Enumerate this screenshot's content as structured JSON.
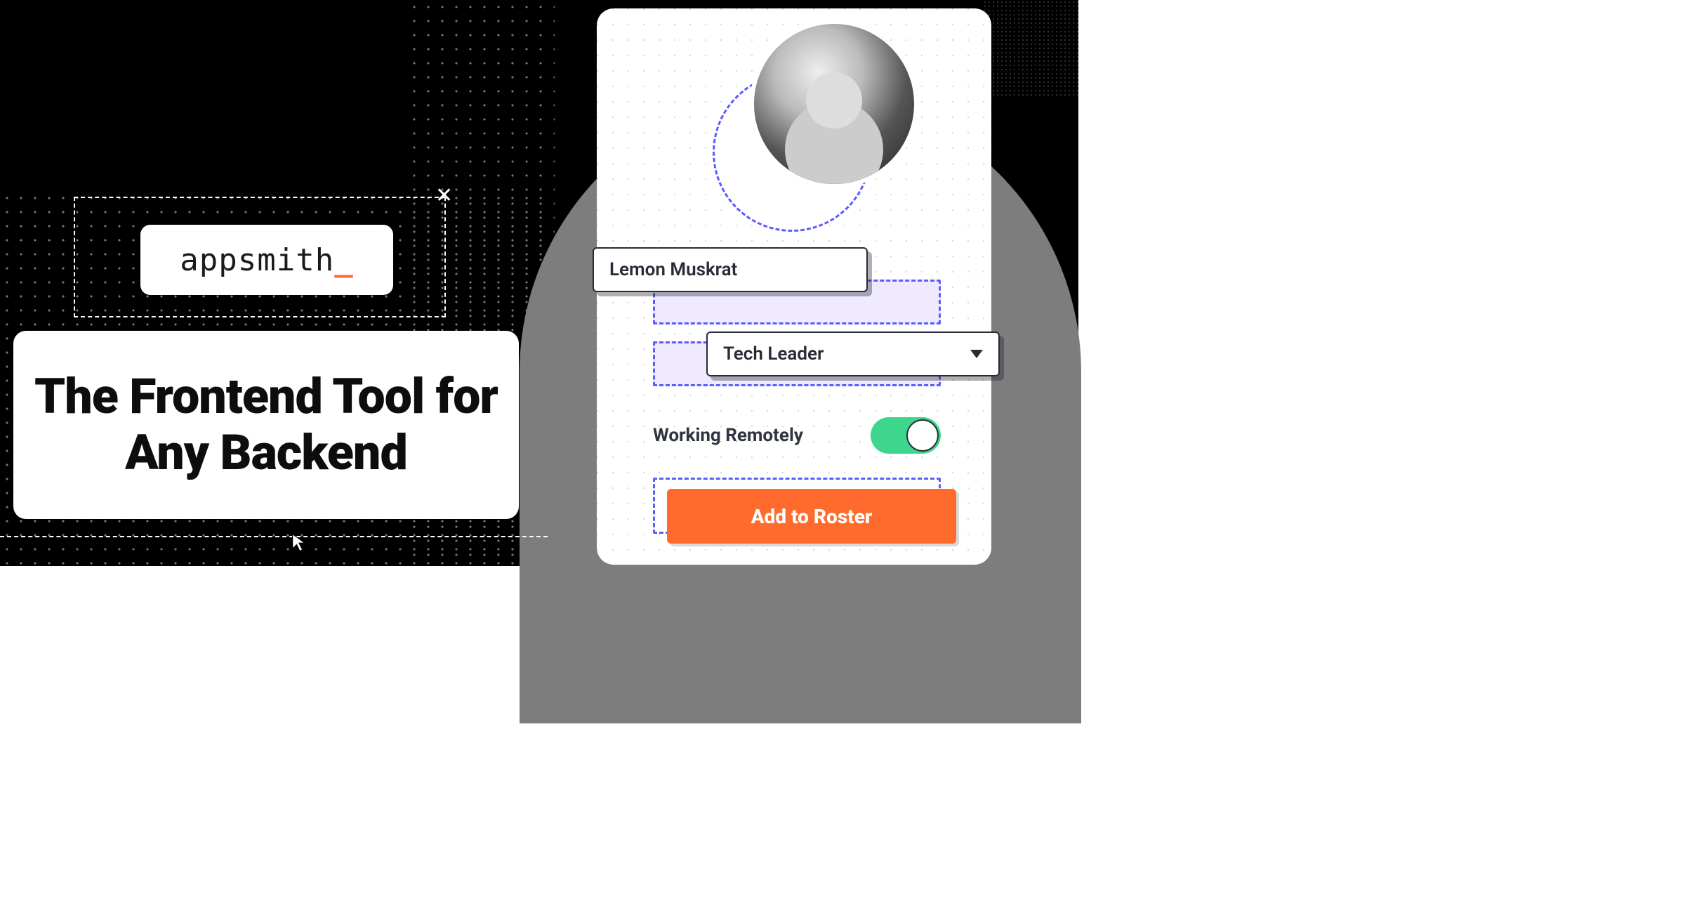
{
  "brand": {
    "name": "appsmith",
    "underscore": "_"
  },
  "headline": "The Frontend Tool for Any Backend",
  "form": {
    "name_value": "Lemon Muskrat",
    "role_value": "Tech Leader",
    "toggle_label": "Working Remotely",
    "toggle_on": true,
    "cta_label": "Add to Roster"
  },
  "icons": {
    "close": "✕",
    "cursor": "cursor-icon",
    "caret": "caret-down-icon"
  }
}
